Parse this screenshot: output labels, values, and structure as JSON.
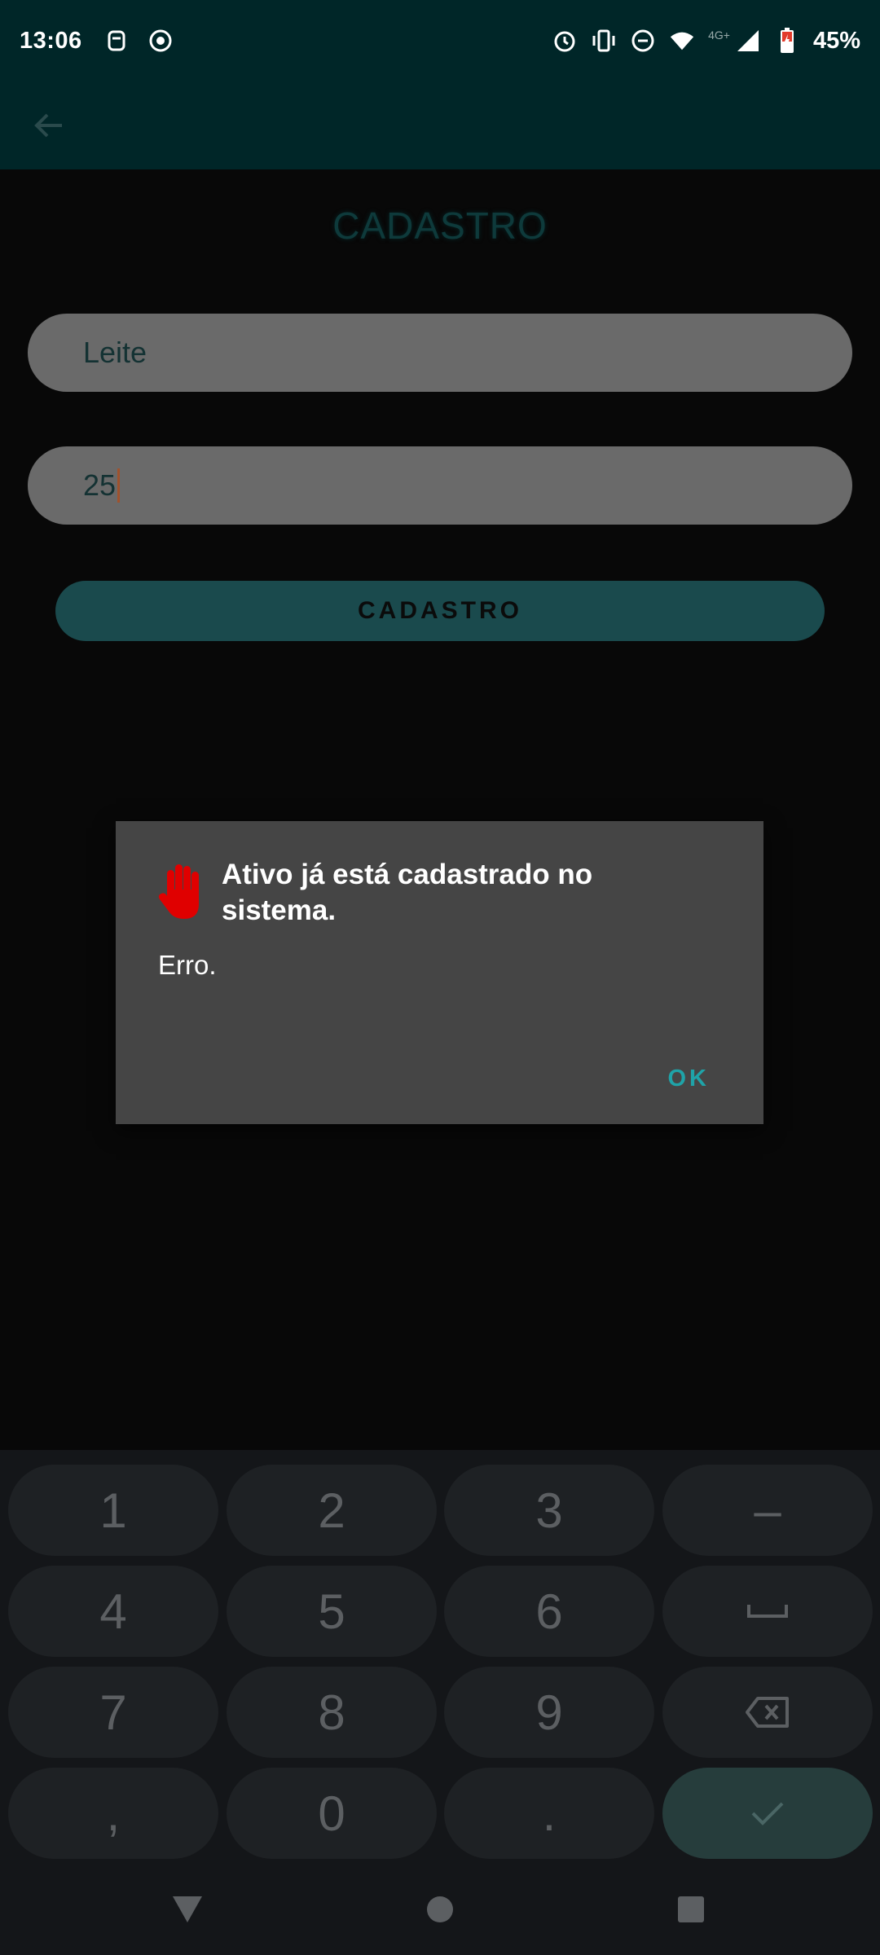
{
  "status_bar": {
    "time": "13:06",
    "network_label": "4G+",
    "battery": "45%"
  },
  "page": {
    "title": "CADASTRO"
  },
  "form": {
    "name_value": "Leite",
    "quantity_value": "25",
    "submit_label": "CADASTRO"
  },
  "dialog": {
    "title": "Ativo já está cadastrado no sistema.",
    "message": "Erro.",
    "ok_label": "OK",
    "icon": "stop-hand-icon",
    "icon_color": "#e00000"
  },
  "keyboard": {
    "keys": [
      "1",
      "2",
      "3",
      "–",
      "4",
      "5",
      "6",
      "␣",
      "7",
      "8",
      "9",
      "⌫",
      ",",
      "0",
      ".",
      "✓"
    ]
  },
  "colors": {
    "status_bar": "#002628",
    "accent": "#1fa3a8",
    "dialog_bg": "#454545"
  }
}
